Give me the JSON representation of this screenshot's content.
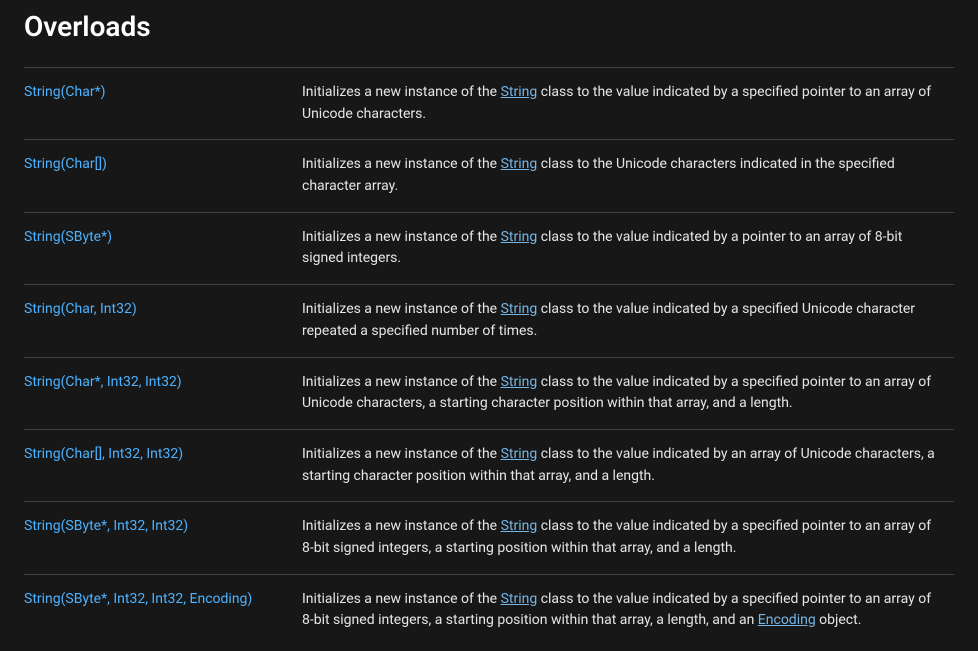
{
  "heading": "Overloads",
  "desc_prefix": "Initializes a new instance of the ",
  "string_link_label": "String",
  "rows": [
    {
      "signature": "String(Char*)",
      "suffix_before": " class to the value indicated by a specified pointer to an array of Unicode characters.",
      "extra_link": null,
      "suffix_after": ""
    },
    {
      "signature": "String(Char[])",
      "suffix_before": " class to the Unicode characters indicated in the specified character array.",
      "extra_link": null,
      "suffix_after": ""
    },
    {
      "signature": "String(SByte*)",
      "suffix_before": " class to the value indicated by a pointer to an array of 8-bit signed integers.",
      "extra_link": null,
      "suffix_after": ""
    },
    {
      "signature": "String(Char, Int32)",
      "suffix_before": " class to the value indicated by a specified Unicode character repeated a specified number of times.",
      "extra_link": null,
      "suffix_after": ""
    },
    {
      "signature": "String(Char*, Int32, Int32)",
      "suffix_before": " class to the value indicated by a specified pointer to an array of Unicode characters, a starting character position within that array, and a length.",
      "extra_link": null,
      "suffix_after": ""
    },
    {
      "signature": "String(Char[], Int32, Int32)",
      "suffix_before": " class to the value indicated by an array of Unicode characters, a starting character position within that array, and a length.",
      "extra_link": null,
      "suffix_after": ""
    },
    {
      "signature": "String(SByte*, Int32, Int32)",
      "suffix_before": " class to the value indicated by a specified pointer to an array of 8-bit signed integers, a starting position within that array, and a length.",
      "extra_link": null,
      "suffix_after": ""
    },
    {
      "signature": "String(SByte*, Int32, Int32, Encoding)",
      "suffix_before": " class to the value indicated by a specified pointer to an array of 8-bit signed integers, a starting position within that array, a length, and an ",
      "extra_link": "Encoding",
      "suffix_after": " object."
    }
  ]
}
